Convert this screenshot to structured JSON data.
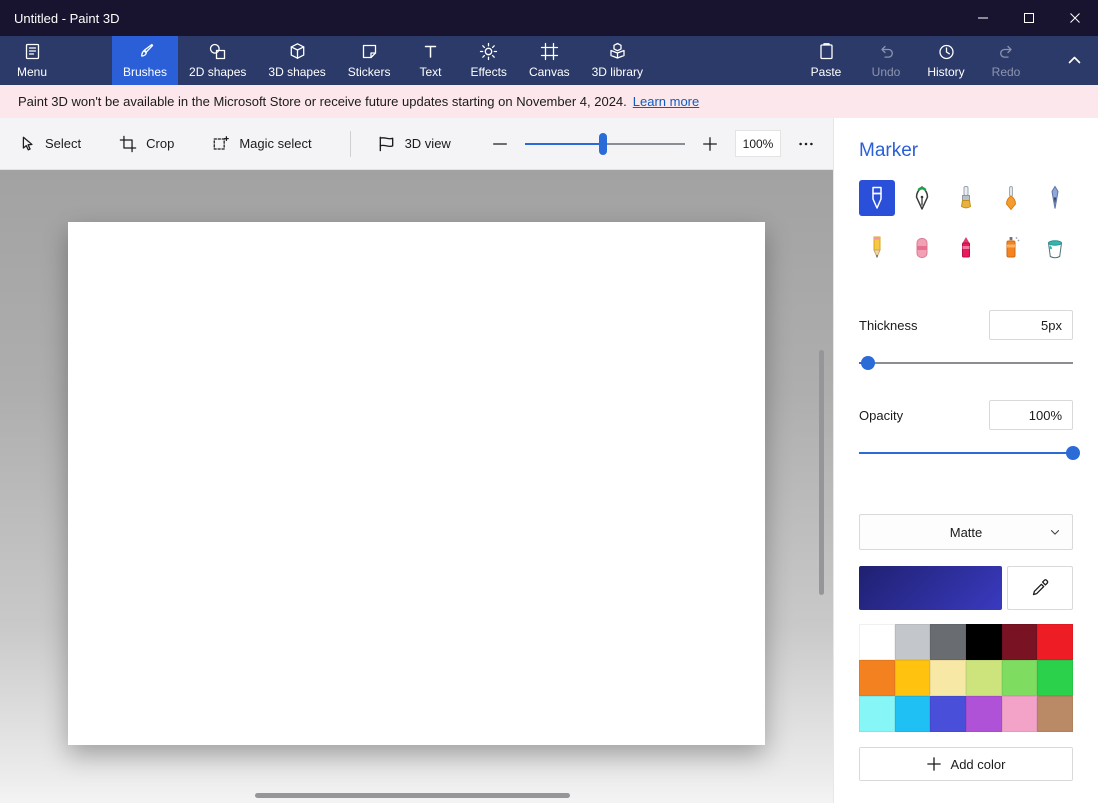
{
  "window": {
    "title": "Untitled - Paint 3D"
  },
  "ribbon": {
    "menu": {
      "label": "Menu"
    },
    "tabs": [
      {
        "label": "Brushes",
        "selected": true
      },
      {
        "label": "2D shapes"
      },
      {
        "label": "3D shapes"
      },
      {
        "label": "Stickers"
      },
      {
        "label": "Text"
      },
      {
        "label": "Effects"
      },
      {
        "label": "Canvas"
      },
      {
        "label": "3D library"
      }
    ],
    "actions": [
      {
        "label": "Paste",
        "disabled": false
      },
      {
        "label": "Undo",
        "disabled": true
      },
      {
        "label": "History",
        "disabled": false
      },
      {
        "label": "Redo",
        "disabled": true
      }
    ]
  },
  "banner": {
    "message": "Paint 3D won't be available in the Microsoft Store or receive future updates starting on November 4, 2024.",
    "link_label": "Learn more"
  },
  "toolbar": {
    "select_label": "Select",
    "crop_label": "Crop",
    "magic_select_label": "Magic select",
    "view3d_label": "3D view",
    "zoom_value": "100%",
    "zoom_percent": 49
  },
  "panel": {
    "title": "Marker",
    "tools": [
      {
        "name": "Marker",
        "selected": true
      },
      {
        "name": "Calligraphy pen",
        "selected": false
      },
      {
        "name": "Oil brush",
        "selected": false
      },
      {
        "name": "Watercolour",
        "selected": false
      },
      {
        "name": "Pixel pen",
        "selected": false
      },
      {
        "name": "Pencil",
        "selected": false
      },
      {
        "name": "Eraser",
        "selected": false
      },
      {
        "name": "Crayon",
        "selected": false
      },
      {
        "name": "Spray can",
        "selected": false
      },
      {
        "name": "Fill",
        "selected": false
      }
    ],
    "thickness": {
      "label": "Thickness",
      "value": "5px",
      "percent": 4
    },
    "opacity": {
      "label": "Opacity",
      "value": "100%",
      "percent": 100
    },
    "finish": {
      "value": "Matte"
    },
    "current_color": "#3a3ac0",
    "current_color_dark": "#1f2070",
    "palette": [
      "#ffffff",
      "#c3c6ca",
      "#696d72",
      "#000000",
      "#791222",
      "#ee1c25",
      "#f4811f",
      "#ffc20e",
      "#f8e8a6",
      "#cde37c",
      "#7edd61",
      "#2bd04b",
      "#86f6f6",
      "#1fc0f4",
      "#4a4fd9",
      "#b052d8",
      "#f4a3c8",
      "#b98a65"
    ],
    "add_color_label": "Add color"
  },
  "colors": {
    "accent_blue": "#2a5fd8",
    "titlebar": "#18142f",
    "ribbon": "#2b3a68",
    "banner_bg": "#fbe7ec",
    "toolbar_bg": "#f4f4f6"
  },
  "icons": [
    "menu-icon",
    "brush-icon",
    "2d-shapes-icon",
    "3d-shapes-icon",
    "stickers-icon",
    "text-icon",
    "effects-icon",
    "canvas-icon",
    "3d-library-icon",
    "paste-icon",
    "undo-icon",
    "history-icon",
    "redo-icon",
    "collapse-ribbon-icon",
    "minimize-icon",
    "maximize-icon",
    "close-icon",
    "select-cursor-icon",
    "crop-icon",
    "magic-select-icon",
    "3d-view-icon",
    "zoom-out-icon",
    "zoom-in-icon",
    "more-icon",
    "marker-tool-icon",
    "calligraphy-pen-icon",
    "oil-brush-icon",
    "watercolor-icon",
    "pixel-pen-icon",
    "pencil-icon",
    "eraser-icon",
    "crayon-icon",
    "spray-can-icon",
    "fill-icon",
    "dropdown-chevron-icon",
    "eyedropper-icon",
    "add-color-icon"
  ]
}
